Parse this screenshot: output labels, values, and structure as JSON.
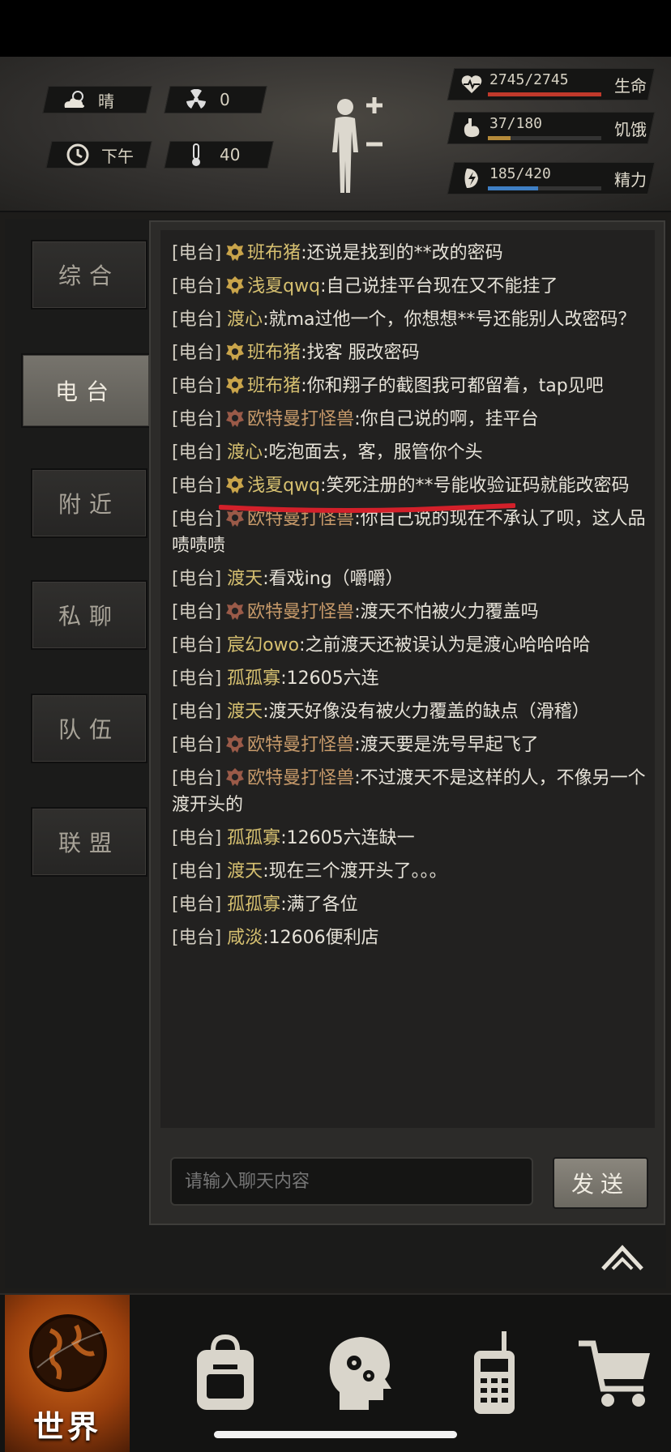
{
  "hud": {
    "weather": {
      "icon": "cloud-sun-icon",
      "label": "晴"
    },
    "radiation": {
      "icon": "radiation-icon",
      "value": "0"
    },
    "time_of_day": {
      "icon": "clock-icon",
      "label": "下午"
    },
    "temperature": {
      "icon": "thermometer-icon",
      "value": "40"
    },
    "health": {
      "value": "2745/2745",
      "label": "生命",
      "fill_fraction": 1.0,
      "color": "#c0392b"
    },
    "hunger": {
      "value": "37/180",
      "label": "饥饿",
      "fill_fraction": 0.2,
      "color": "#b58a3a"
    },
    "energy": {
      "value": "185/420",
      "label": "精力",
      "fill_fraction": 0.44,
      "color": "#3f7fc4"
    }
  },
  "tabs": [
    {
      "label": "综合",
      "active": false
    },
    {
      "label": "电台",
      "active": true
    },
    {
      "label": "附近",
      "active": false
    },
    {
      "label": "私聊",
      "active": false
    },
    {
      "label": "队伍",
      "active": false
    },
    {
      "label": "联盟",
      "active": false
    }
  ],
  "chat": {
    "channel_tag": "[电台]",
    "messages": [
      {
        "badge": "gold",
        "name": "班布猪",
        "text": ":还说是找到的**改的密码"
      },
      {
        "badge": "gold",
        "name": "浅夏qwq",
        "text": ":自己说挂平台现在又不能挂了"
      },
      {
        "badge": "none",
        "name": "渡心",
        "text": ":就ma过他一个，你想想**号还能别人改密码？"
      },
      {
        "badge": "gold",
        "name": "班布猪",
        "text": ":找客 服改密码"
      },
      {
        "badge": "gold",
        "name": "班布猪",
        "text": ":你和翔子的截图我可都留着，tap见吧"
      },
      {
        "badge": "red",
        "name": "欧特曼打怪兽",
        "text": ":你自己说的啊，挂平台"
      },
      {
        "badge": "none",
        "name": "渡心",
        "text": ":吃泡面去，客，服管你个头"
      },
      {
        "badge": "gold",
        "name": "浅夏qwq",
        "text": ":笑死注册的**号能收验证码就能改密码"
      },
      {
        "badge": "red",
        "name": "欧特曼打怪兽",
        "text": ":你自己说的现在不承认了呗，这人品啧啧啧"
      },
      {
        "badge": "none",
        "name": "渡天",
        "text": ":看戏ing（嚼嚼）"
      },
      {
        "badge": "red",
        "name": "欧特曼打怪兽",
        "text": ":渡天不怕被火力覆盖吗"
      },
      {
        "badge": "none",
        "name": "宸幻owo",
        "text": ":之前渡天还被误认为是渡心哈哈哈哈"
      },
      {
        "badge": "none",
        "name": "孤孤寡",
        "text": ":12605六连"
      },
      {
        "badge": "none",
        "name": "渡天",
        "text": ":渡天好像没有被火力覆盖的缺点（滑稽）"
      },
      {
        "badge": "red",
        "name": "欧特曼打怪兽",
        "text": ":渡天要是洗号早起飞了"
      },
      {
        "badge": "red",
        "name": "欧特曼打怪兽",
        "text": ":不过渡天不是这样的人，不像另一个渡开头的"
      },
      {
        "badge": "none",
        "name": "孤孤寡",
        "text": ":12605六连缺一"
      },
      {
        "badge": "none",
        "name": "渡天",
        "text": ":现在三个渡开头了。。。"
      },
      {
        "badge": "none",
        "name": "孤孤寡",
        "text": ":满了各位"
      },
      {
        "badge": "none",
        "name": "咸淡",
        "text": ":12606便利店"
      }
    ],
    "input_placeholder": "请输入聊天内容",
    "send_label": "发送"
  },
  "bottom_nav": {
    "world_label": "世界",
    "items": [
      "globe-icon",
      "backpack-icon",
      "skills-head-icon",
      "radio-phone-icon",
      "cart-icon"
    ]
  },
  "colors": {
    "accent_orange": "#c65e16",
    "underline_red": "#d3202a"
  }
}
